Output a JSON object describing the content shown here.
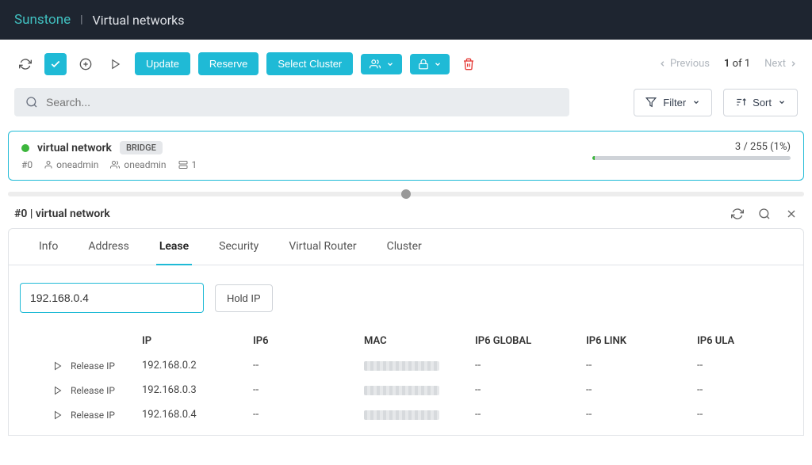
{
  "header": {
    "brand": "Sunstone",
    "title": "Virtual networks"
  },
  "toolbar": {
    "update_label": "Update",
    "reserve_label": "Reserve",
    "select_cluster_label": "Select Cluster"
  },
  "pager": {
    "previous": "Previous",
    "next": "Next",
    "current": "1",
    "total": "of 1"
  },
  "search": {
    "placeholder": "Search..."
  },
  "controls": {
    "filter_label": "Filter",
    "sort_label": "Sort"
  },
  "card": {
    "name": "virtual network",
    "badge": "BRIDGE",
    "id": "#0",
    "owner": "oneadmin",
    "group": "oneadmin",
    "count": "1",
    "usage": "3 / 255 (1%)"
  },
  "detail": {
    "title": "#0 | virtual network"
  },
  "tabs": {
    "info": "Info",
    "address": "Address",
    "lease": "Lease",
    "security": "Security",
    "virtual_router": "Virtual Router",
    "cluster": "Cluster"
  },
  "lease": {
    "ip_input_value": "192.168.0.4",
    "hold_label": "Hold IP",
    "release_label": "Release IP",
    "columns": {
      "ip": "IP",
      "ip6": "IP6",
      "mac": "MAC",
      "ip6global": "IP6 GLOBAL",
      "ip6link": "IP6 LINK",
      "ip6ula": "IP6 ULA"
    },
    "rows": [
      {
        "ip": "192.168.0.2",
        "ip6": "--",
        "ip6global": "--",
        "ip6link": "--",
        "ip6ula": "--"
      },
      {
        "ip": "192.168.0.3",
        "ip6": "--",
        "ip6global": "--",
        "ip6link": "--",
        "ip6ula": "--"
      },
      {
        "ip": "192.168.0.4",
        "ip6": "--",
        "ip6global": "--",
        "ip6link": "--",
        "ip6ula": "--"
      }
    ]
  }
}
